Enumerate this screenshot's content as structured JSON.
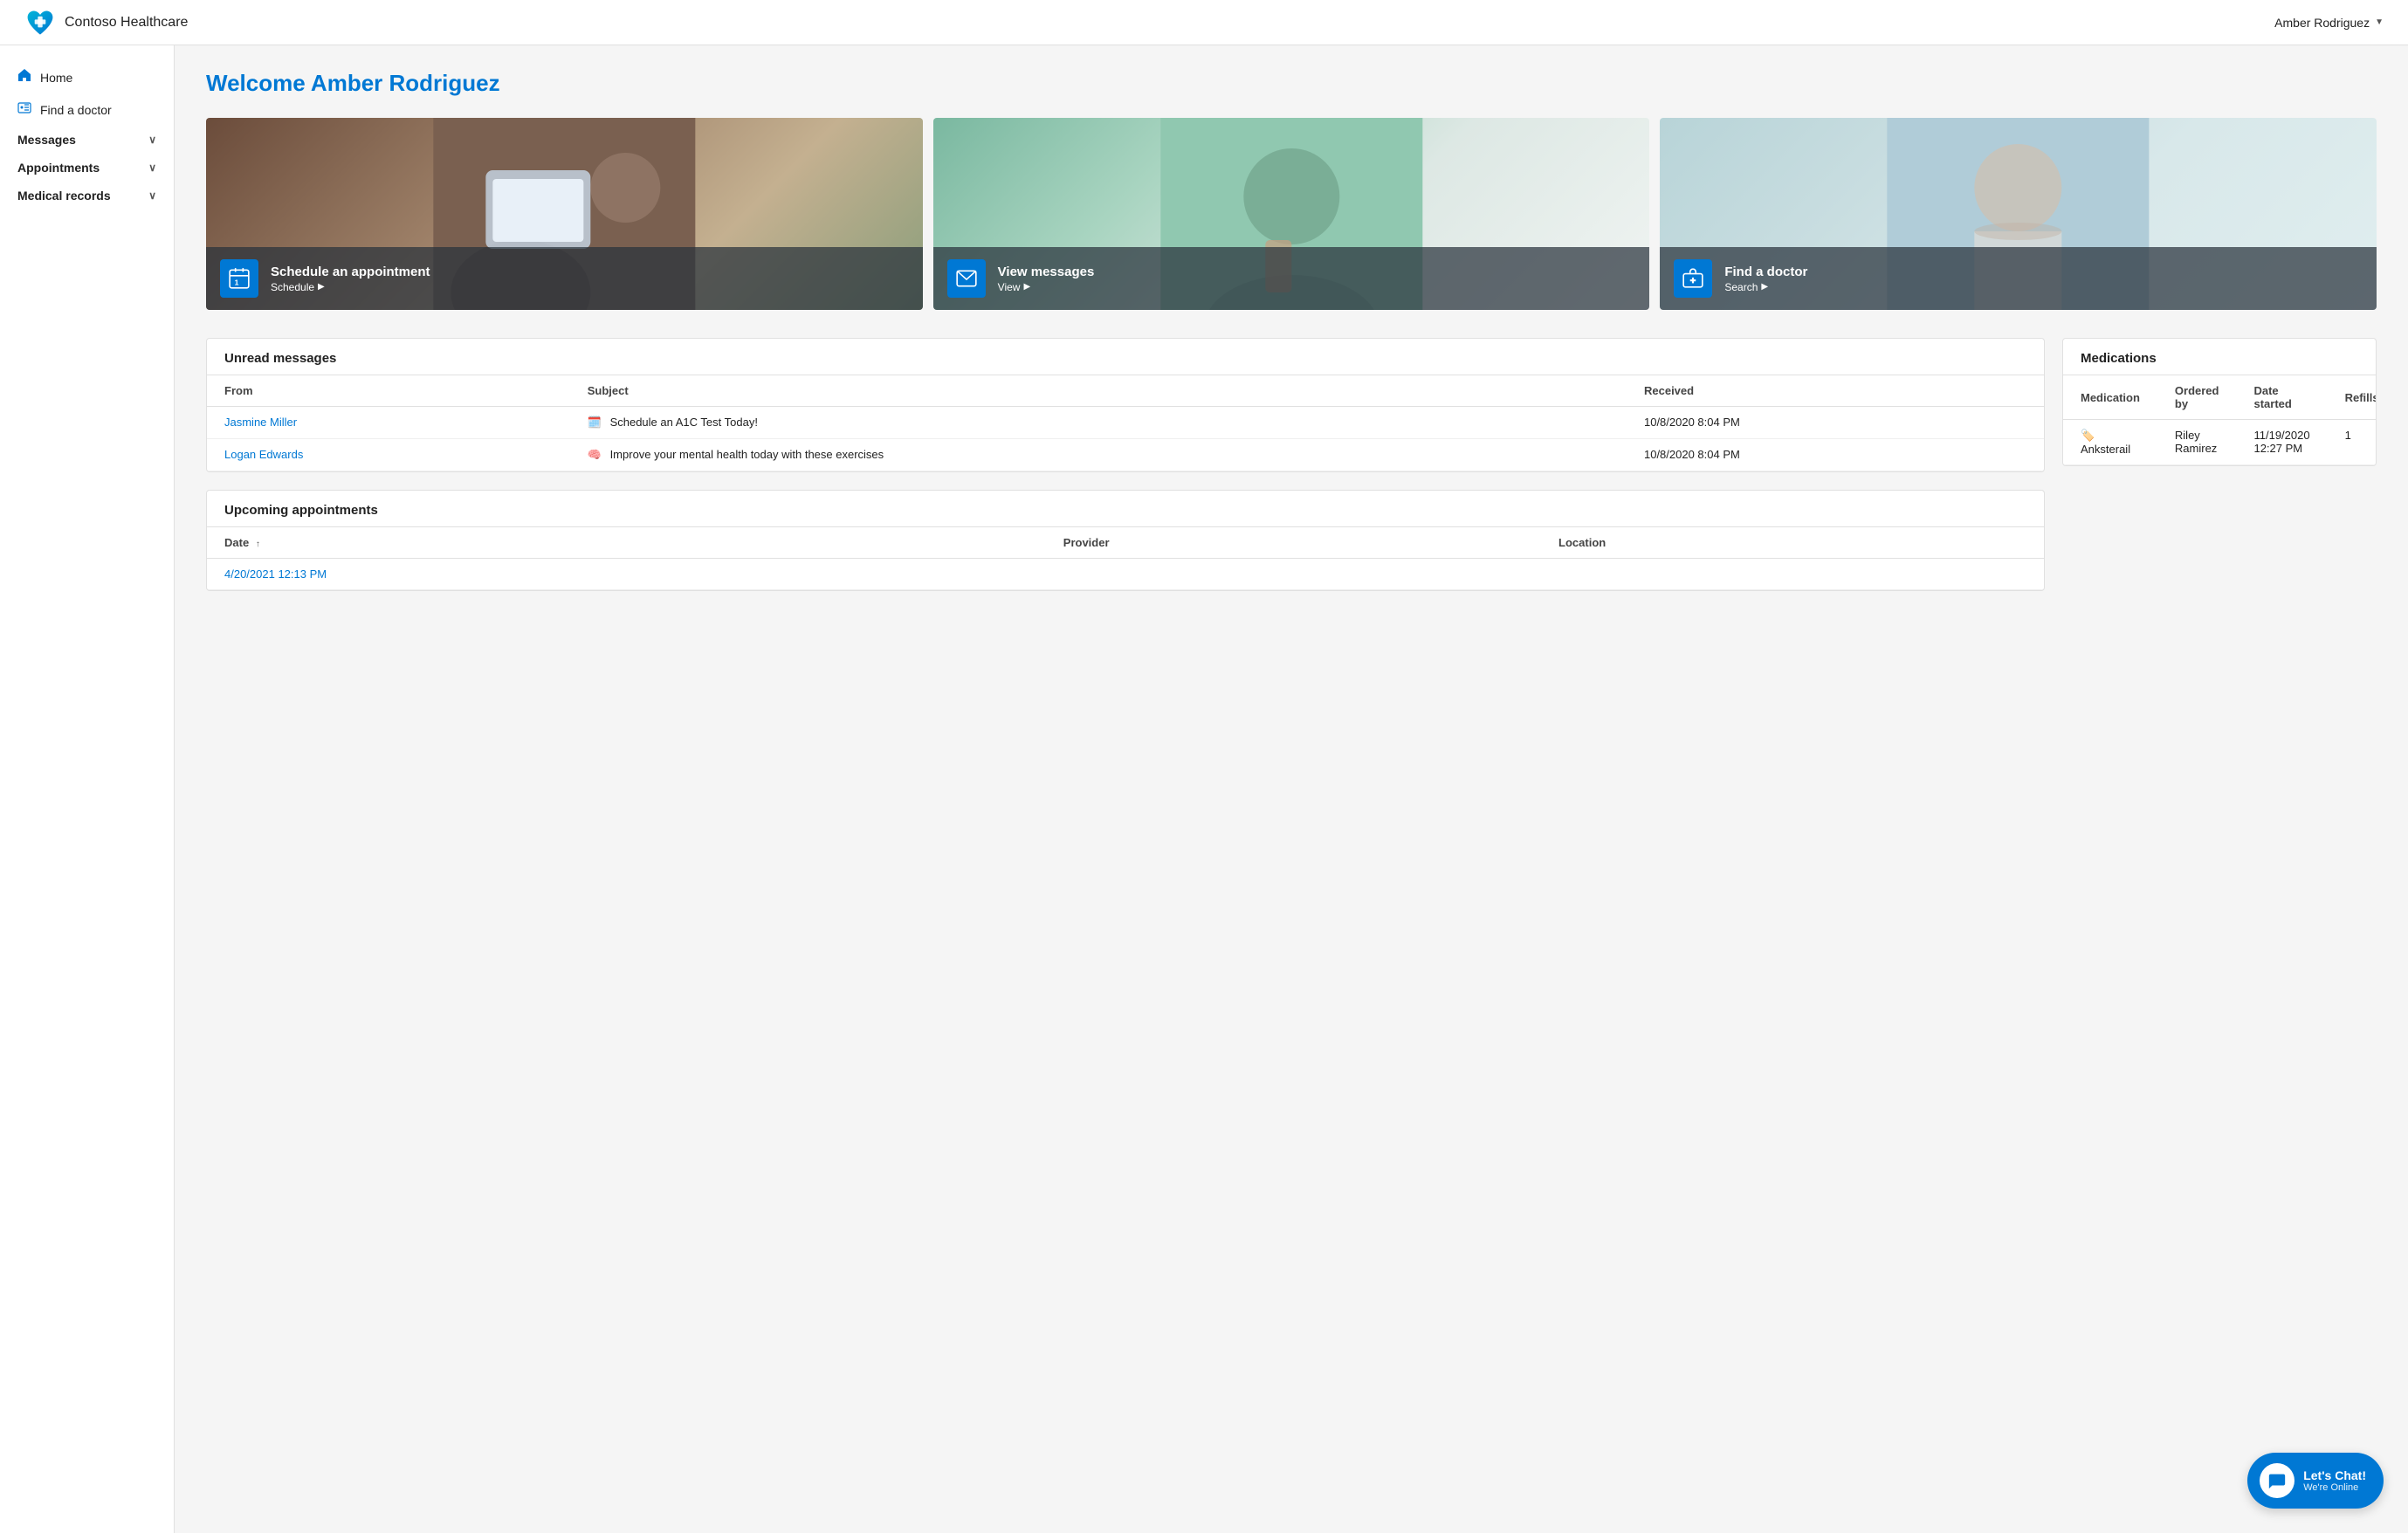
{
  "header": {
    "brand_name": "Contoso Healthcare",
    "user_name": "Amber Rodriguez"
  },
  "sidebar": {
    "items": [
      {
        "id": "home",
        "label": "Home",
        "icon": "home",
        "has_chevron": false
      },
      {
        "id": "find-doctor",
        "label": "Find a doctor",
        "icon": "doctor",
        "has_chevron": false
      },
      {
        "id": "messages",
        "label": "Messages",
        "icon": null,
        "has_chevron": true
      },
      {
        "id": "appointments",
        "label": "Appointments",
        "icon": null,
        "has_chevron": true
      },
      {
        "id": "medical-records",
        "label": "Medical records",
        "icon": null,
        "has_chevron": true
      }
    ]
  },
  "welcome": {
    "title": "Welcome Amber Rodriguez"
  },
  "hero_cards": [
    {
      "id": "schedule",
      "title": "Schedule an appointment",
      "link_label": "Schedule",
      "icon": "calendar"
    },
    {
      "id": "messages",
      "title": "View messages",
      "link_label": "View",
      "icon": "envelope"
    },
    {
      "id": "find-doctor",
      "title": "Find a doctor",
      "link_label": "Search",
      "icon": "medical-bag"
    }
  ],
  "unread_messages": {
    "title": "Unread messages",
    "columns": [
      "From",
      "Subject",
      "Received"
    ],
    "rows": [
      {
        "from": "Jasmine Miller",
        "subject_icon": "calendar-msg",
        "subject": "Schedule an A1C Test Today!",
        "received": "10/8/2020 8:04 PM"
      },
      {
        "from": "Logan Edwards",
        "subject_icon": "brain",
        "subject": "Improve your mental health today with these exercises",
        "received": "10/8/2020 8:04 PM"
      }
    ]
  },
  "upcoming_appointments": {
    "title": "Upcoming appointments",
    "columns": [
      {
        "label": "Date",
        "sort": true
      },
      {
        "label": "Provider",
        "sort": false
      },
      {
        "label": "Location",
        "sort": false
      }
    ],
    "rows": [
      {
        "date": "4/20/2021 12:13 PM",
        "provider": "",
        "location": ""
      }
    ]
  },
  "medications": {
    "title": "Medications",
    "columns": [
      "Medication",
      "Ordered by",
      "Date started",
      "Refills"
    ],
    "rows": [
      {
        "medication": "Anksterail",
        "ordered_by": "Riley Ramirez",
        "date_started": "11/19/2020 12:27 PM",
        "refills": "1"
      }
    ]
  },
  "chat_button": {
    "title": "Let's Chat!",
    "subtitle": "We're Online"
  }
}
